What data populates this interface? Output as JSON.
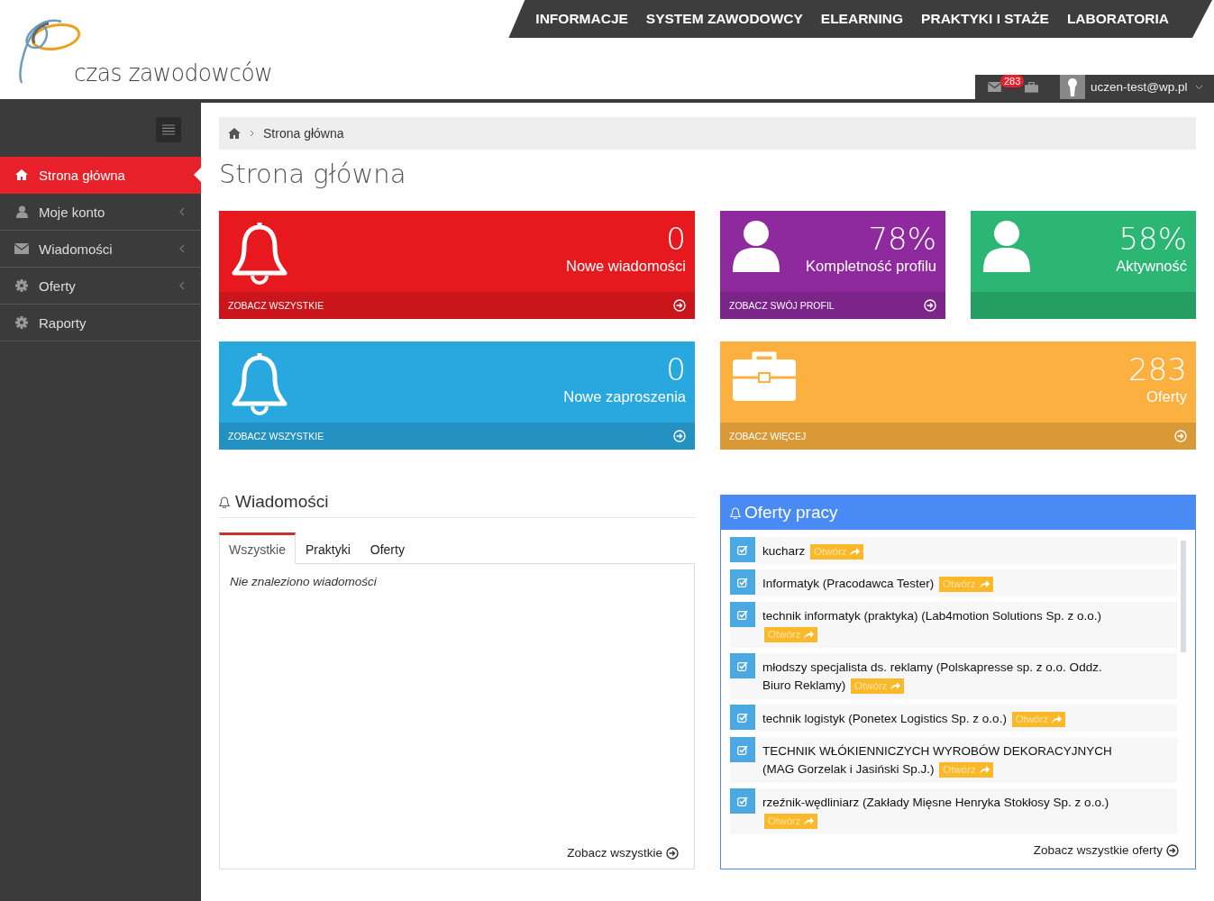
{
  "logo": {
    "text": "czas zawodowców"
  },
  "top_nav": [
    {
      "label": "INFORMACJE"
    },
    {
      "label": "SYSTEM ZAWODOWCY"
    },
    {
      "label": "ELEARNING"
    },
    {
      "label": "PRAKTYKI I STAŻE"
    },
    {
      "label": "LABORATORIA"
    }
  ],
  "user_bar": {
    "badge": "283",
    "email": "uczen-test@wp.pl"
  },
  "sidebar": {
    "items": [
      {
        "label": "Strona główna",
        "kind": "home",
        "selected": true,
        "expandable": false
      },
      {
        "label": "Moje konto",
        "kind": "user",
        "selected": false,
        "expandable": true
      },
      {
        "label": "Wiadomości",
        "kind": "envelope",
        "selected": false,
        "expandable": true
      },
      {
        "label": "Oferty",
        "kind": "gear",
        "selected": false,
        "expandable": true
      },
      {
        "label": "Raporty",
        "kind": "gear",
        "selected": false,
        "expandable": false
      }
    ]
  },
  "breadcrumb": {
    "current": "Strona główna"
  },
  "page_title": "Strona główna",
  "stat_cards": [
    {
      "value": "0",
      "label": "Nowe wiadomości",
      "link": "ZOBACZ WSZYSTKIE",
      "kind": "bell",
      "color": "#e8191e"
    },
    {
      "value": "78%",
      "label": "Kompletność profilu",
      "link": "ZOBACZ SWÓJ PROFIL",
      "kind": "user",
      "color": "#8e2a9e"
    },
    {
      "value": "58%",
      "label": "Aktywność",
      "kind": "user",
      "color": "#2bb673"
    },
    {
      "value": "0",
      "label": "Nowe zaproszenia",
      "link": "ZOBACZ WSZYSTKIE",
      "kind": "bell",
      "color": "#29a8e0"
    },
    {
      "value": "283",
      "label": "Oferty",
      "link": "ZOBACZ WIĘCEJ",
      "kind": "briefcase",
      "color": "#fbb040"
    }
  ],
  "messages": {
    "title": "Wiadomości",
    "tabs": [
      {
        "label": "Wszystkie",
        "selected": true
      },
      {
        "label": "Praktyki",
        "selected": false
      },
      {
        "label": "Oferty",
        "selected": false
      }
    ],
    "empty_text": "Nie znaleziono wiadomości",
    "footer_link": "Zobacz wszystkie"
  },
  "offers": {
    "title": "Oferty pracy",
    "items": [
      {
        "lines": [
          "kucharz"
        ],
        "button": "Otwórz"
      },
      {
        "lines": [
          "Informatyk (Pracodawca Tester)"
        ],
        "button": "Otwórz"
      },
      {
        "lines": [
          "technik informatyk (praktyka) (Lab4motion Solutions Sp. z o.o.)"
        ],
        "button": "Otwórz"
      },
      {
        "lines": [
          "młodszy specjalista ds. reklamy (Polskapresse sp. z o.o. Oddz.",
          "Biuro Reklamy)"
        ],
        "button": "Otwórz"
      },
      {
        "lines": [
          "technik logistyk (Ponetex Logistics Sp. z o.o.)"
        ],
        "button": "Otwórz"
      },
      {
        "lines": [
          "TECHNIK WŁÓKIENNICZYCH WYROBÓW DEKORACYJNYCH",
          "(MAG Gorzelak i Jasiński Sp.J.)"
        ],
        "button": "Otwórz"
      },
      {
        "lines": [
          "rzeźnik-wędliniarz (Zakłady Mięsne Henryka Stokłosy Sp. z o.o.)"
        ],
        "button": "Otwórz"
      }
    ],
    "footer_link": "Zobacz wszystkie oferty"
  }
}
